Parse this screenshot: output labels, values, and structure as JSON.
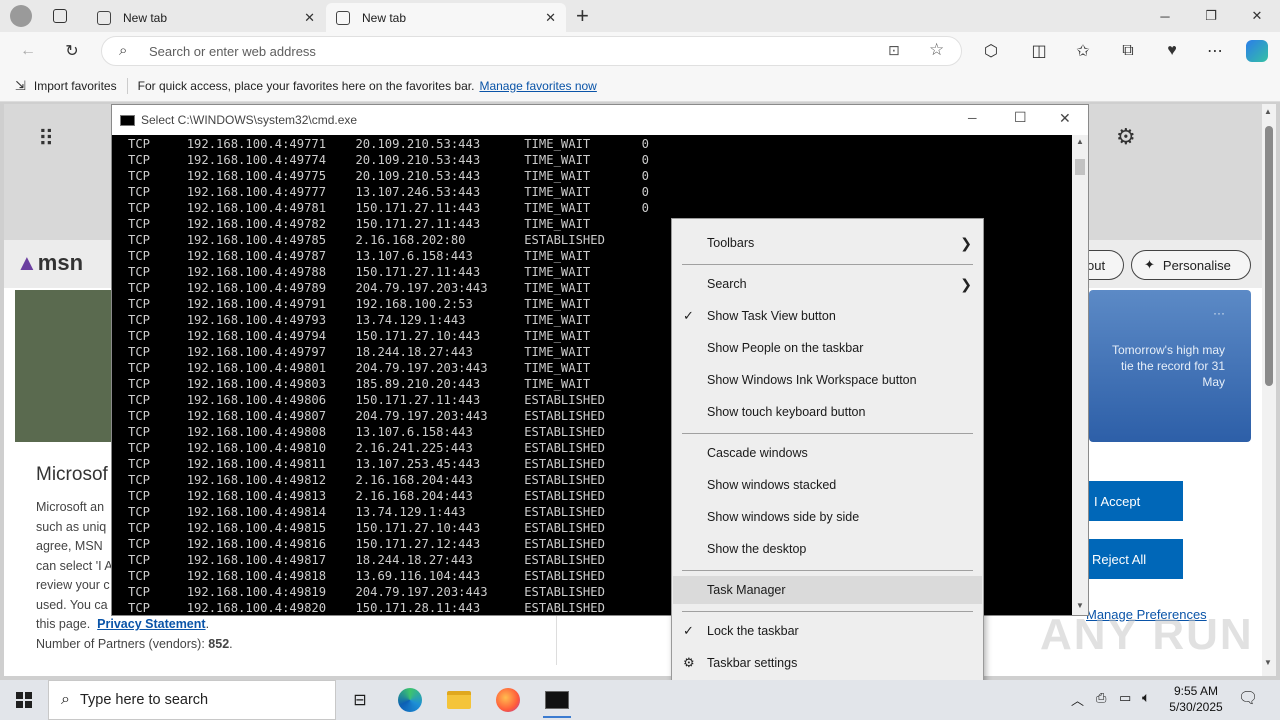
{
  "browser": {
    "tabs": [
      {
        "title": "New tab",
        "active": false
      },
      {
        "title": "New tab",
        "active": true
      }
    ],
    "address_placeholder": "Search or enter web address",
    "favorites_bar": {
      "import": "Import favorites",
      "hint": "For quick access, place your favorites here on the favorites bar.",
      "manage_link": "Manage favorites now"
    }
  },
  "msn": {
    "logo": "msn",
    "buttons": {
      "signout_partial": "out",
      "personalise": "Personalise"
    },
    "weather": "Tomorrow's high may tie the record for 31 May",
    "weather_more": "···"
  },
  "consent": {
    "title": "Microsof",
    "body_lines": [
      "Microsoft an",
      "such as uniq",
      "agree, MSN",
      "can select 'I A",
      "review your c",
      "used. You ca"
    ],
    "footer_prefix": "this page.",
    "privacy_link": "Privacy Statement",
    "partners_label": "Number of Partners (vendors):",
    "partners_count": "852",
    "accept": "I Accept",
    "reject": "Reject All",
    "manage": "Manage Preferences"
  },
  "cmd": {
    "title": "Select C:\\WINDOWS\\system32\\cmd.exe",
    "rows": [
      [
        "TCP",
        "192.168.100.4:49771",
        "20.109.210.53:443",
        "TIME_WAIT",
        "0"
      ],
      [
        "TCP",
        "192.168.100.4:49774",
        "20.109.210.53:443",
        "TIME_WAIT",
        "0"
      ],
      [
        "TCP",
        "192.168.100.4:49775",
        "20.109.210.53:443",
        "TIME_WAIT",
        "0"
      ],
      [
        "TCP",
        "192.168.100.4:49777",
        "13.107.246.53:443",
        "TIME_WAIT",
        "0"
      ],
      [
        "TCP",
        "192.168.100.4:49781",
        "150.171.27.11:443",
        "TIME_WAIT",
        "0"
      ],
      [
        "TCP",
        "192.168.100.4:49782",
        "150.171.27.11:443",
        "TIME_WAIT",
        ""
      ],
      [
        "TCP",
        "192.168.100.4:49785",
        "2.16.168.202:80",
        "ESTABLISHED",
        ""
      ],
      [
        "TCP",
        "192.168.100.4:49787",
        "13.107.6.158:443",
        "TIME_WAIT",
        ""
      ],
      [
        "TCP",
        "192.168.100.4:49788",
        "150.171.27.11:443",
        "TIME_WAIT",
        ""
      ],
      [
        "TCP",
        "192.168.100.4:49789",
        "204.79.197.203:443",
        "TIME_WAIT",
        ""
      ],
      [
        "TCP",
        "192.168.100.4:49791",
        "192.168.100.2:53",
        "TIME_WAIT",
        ""
      ],
      [
        "TCP",
        "192.168.100.4:49793",
        "13.74.129.1:443",
        "TIME_WAIT",
        ""
      ],
      [
        "TCP",
        "192.168.100.4:49794",
        "150.171.27.10:443",
        "TIME_WAIT",
        ""
      ],
      [
        "TCP",
        "192.168.100.4:49797",
        "18.244.18.27:443",
        "TIME_WAIT",
        ""
      ],
      [
        "TCP",
        "192.168.100.4:49801",
        "204.79.197.203:443",
        "TIME_WAIT",
        ""
      ],
      [
        "TCP",
        "192.168.100.4:49803",
        "185.89.210.20:443",
        "TIME_WAIT",
        ""
      ],
      [
        "TCP",
        "192.168.100.4:49806",
        "150.171.27.11:443",
        "ESTABLISHED",
        ""
      ],
      [
        "TCP",
        "192.168.100.4:49807",
        "204.79.197.203:443",
        "ESTABLISHED",
        ""
      ],
      [
        "TCP",
        "192.168.100.4:49808",
        "13.107.6.158:443",
        "ESTABLISHED",
        ""
      ],
      [
        "TCP",
        "192.168.100.4:49810",
        "2.16.241.225:443",
        "ESTABLISHED",
        ""
      ],
      [
        "TCP",
        "192.168.100.4:49811",
        "13.107.253.45:443",
        "ESTABLISHED",
        ""
      ],
      [
        "TCP",
        "192.168.100.4:49812",
        "2.16.168.204:443",
        "ESTABLISHED",
        ""
      ],
      [
        "TCP",
        "192.168.100.4:49813",
        "2.16.168.204:443",
        "ESTABLISHED",
        ""
      ],
      [
        "TCP",
        "192.168.100.4:49814",
        "13.74.129.1:443",
        "ESTABLISHED",
        ""
      ],
      [
        "TCP",
        "192.168.100.4:49815",
        "150.171.27.10:443",
        "ESTABLISHED",
        ""
      ],
      [
        "TCP",
        "192.168.100.4:49816",
        "150.171.27.12:443",
        "ESTABLISHED",
        ""
      ],
      [
        "TCP",
        "192.168.100.4:49817",
        "18.244.18.27:443",
        "ESTABLISHED",
        ""
      ],
      [
        "TCP",
        "192.168.100.4:49818",
        "13.69.116.104:443",
        "ESTABLISHED",
        ""
      ],
      [
        "TCP",
        "192.168.100.4:49819",
        "204.79.197.203:443",
        "ESTABLISHED",
        ""
      ],
      [
        "TCP",
        "192.168.100.4:49820",
        "150.171.28.11:443",
        "ESTABLISHED",
        ""
      ]
    ]
  },
  "context_menu": {
    "toolbars": "Toolbars",
    "search": "Search",
    "task_view": "Show Task View button",
    "people": "Show People on the taskbar",
    "ink": "Show Windows Ink Workspace button",
    "touch_kb": "Show touch keyboard button",
    "cascade": "Cascade windows",
    "stacked": "Show windows stacked",
    "side_by_side": "Show windows side by side",
    "desktop": "Show the desktop",
    "task_manager": "Task Manager",
    "lock": "Lock the taskbar",
    "settings": "Taskbar settings"
  },
  "taskbar": {
    "search_placeholder": "Type here to search",
    "time": "9:55 AM",
    "date": "5/30/2025"
  },
  "watermark": "ANY RUN"
}
